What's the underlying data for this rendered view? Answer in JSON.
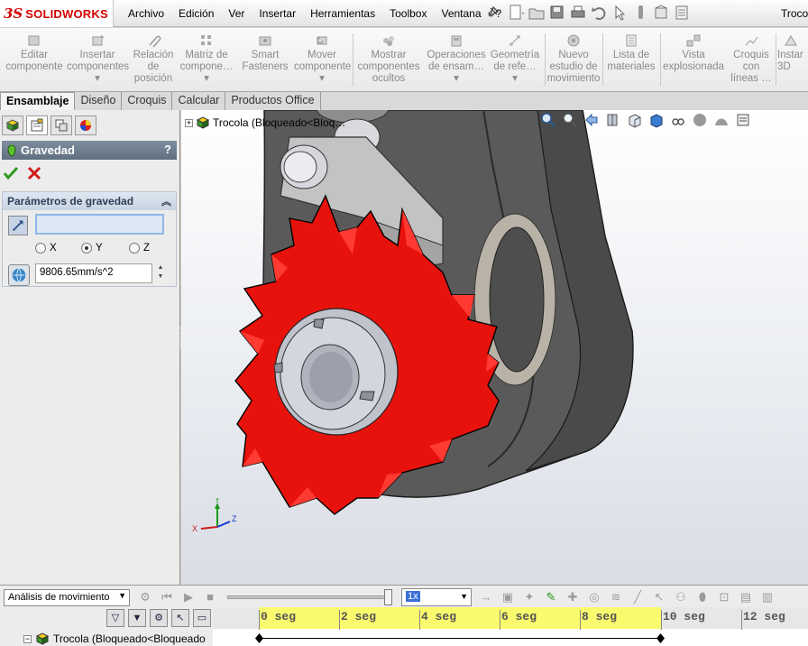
{
  "app": {
    "logo_ds": "3S",
    "logo_name": "SOLIDWORKS",
    "window_title": "Troco"
  },
  "menu": [
    "Archivo",
    "Edición",
    "Ver",
    "Insertar",
    "Herramientas",
    "Toolbox",
    "Ventana",
    "?"
  ],
  "ribbon": {
    "buttons": [
      {
        "label_1": "Editar",
        "label_2": "componente",
        "label_3": ""
      },
      {
        "label_1": "Insertar",
        "label_2": "componentes",
        "label_3": ""
      },
      {
        "label_1": "Relación",
        "label_2": "de",
        "label_3": "posición"
      },
      {
        "label_1": "Matriz de",
        "label_2": "compone…",
        "label_3": ""
      },
      {
        "label_1": "Smart",
        "label_2": "Fasteners",
        "label_3": ""
      },
      {
        "label_1": "Mover",
        "label_2": "componente",
        "label_3": ""
      },
      {
        "label_1": "Mostrar",
        "label_2": "componentes",
        "label_3": "ocultos"
      },
      {
        "label_1": "Operaciones",
        "label_2": "de ensam…",
        "label_3": ""
      },
      {
        "label_1": "Geometría",
        "label_2": "de refe…",
        "label_3": ""
      },
      {
        "label_1": "Nuevo",
        "label_2": "estudio de",
        "label_3": "movimiento"
      },
      {
        "label_1": "Lista de",
        "label_2": "materiales",
        "label_3": ""
      },
      {
        "label_1": "Vista",
        "label_2": "explosionada",
        "label_3": ""
      },
      {
        "label_1": "Croquis",
        "label_2": "con",
        "label_3": "líneas …"
      },
      {
        "label_1": "Instar",
        "label_2": "3D",
        "label_3": ""
      }
    ]
  },
  "tabs": [
    "Ensamblaje",
    "Diseño",
    "Croquis",
    "Calcular",
    "Productos Office"
  ],
  "active_tab": "Ensamblaje",
  "property_manager": {
    "title": "Gravedad",
    "help": "?",
    "section_title": "Parámetros de gravedad",
    "direction_value": "",
    "axes": [
      "X",
      "Y",
      "Z"
    ],
    "selected_axis": "Y",
    "gravity_value": "9806.65mm/s^2"
  },
  "graphics": {
    "tree_root_label": "Trocola  (Bloqueado<Bloq…",
    "triad_labels": {
      "x": "X",
      "y": "Y",
      "z": "Z"
    },
    "colors": {
      "gear": "#e8120c",
      "housing": "#5c5c5c",
      "bracket": "#bdbdbd"
    }
  },
  "motion_study": {
    "study_type": "Análisis de movimiento",
    "speed": "1x",
    "time_ticks": [
      "0 seg",
      "2 seg",
      "4 seg",
      "6 seg",
      "8 seg",
      "10 seg",
      "12 seg"
    ],
    "tree_item": "Trocola  (Bloqueado<Bloqueado"
  }
}
